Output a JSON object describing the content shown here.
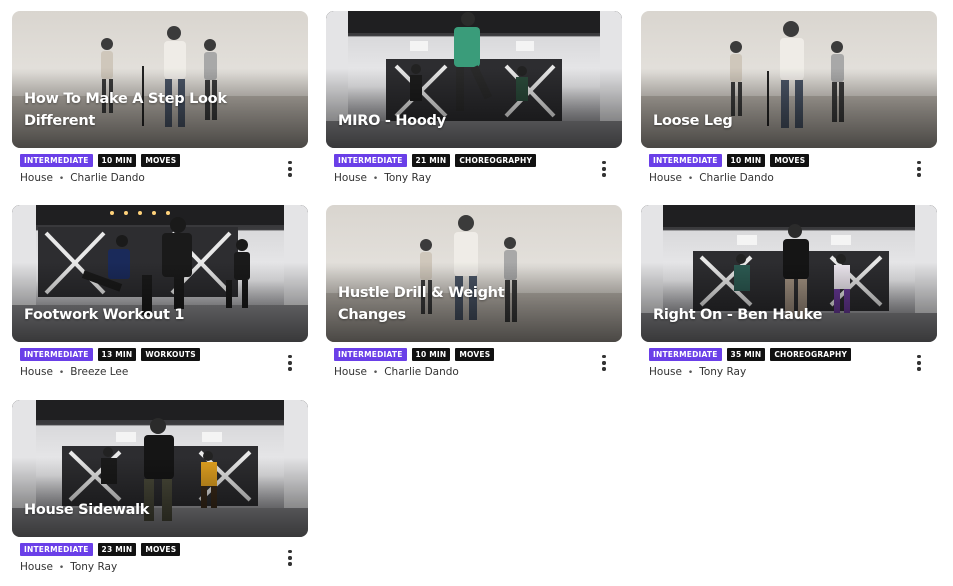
{
  "cards": [
    {
      "title": "How To Make A Step Look Different",
      "level": "INTERMEDIATE",
      "duration": "10 MIN",
      "category": "MOVES",
      "style": "House",
      "instructor": "Charlie Dando"
    },
    {
      "title": "MIRO - Hoody",
      "level": "INTERMEDIATE",
      "duration": "21 MIN",
      "category": "CHOREOGRAPHY",
      "style": "House",
      "instructor": "Tony Ray"
    },
    {
      "title": "Loose Leg",
      "level": "INTERMEDIATE",
      "duration": "10 MIN",
      "category": "MOVES",
      "style": "House",
      "instructor": "Charlie Dando"
    },
    {
      "title": "Footwork Workout 1",
      "level": "INTERMEDIATE",
      "duration": "13 MIN",
      "category": "WORKOUTS",
      "style": "House",
      "instructor": "Breeze Lee"
    },
    {
      "title": "Hustle Drill & Weight Changes",
      "level": "INTERMEDIATE",
      "duration": "10 MIN",
      "category": "MOVES",
      "style": "House",
      "instructor": "Charlie Dando"
    },
    {
      "title": "Right On - Ben Hauke",
      "level": "INTERMEDIATE",
      "duration": "35 MIN",
      "category": "CHOREOGRAPHY",
      "style": "House",
      "instructor": "Tony Ray"
    },
    {
      "title": "House Sidewalk",
      "level": "INTERMEDIATE",
      "duration": "23 MIN",
      "category": "MOVES",
      "style": "House",
      "instructor": "Tony Ray"
    }
  ],
  "separator": "•",
  "colors": {
    "level_badge": "#6a3fe8",
    "tag_badge": "#111111"
  },
  "icons": {
    "more": "more-vertical-icon"
  }
}
